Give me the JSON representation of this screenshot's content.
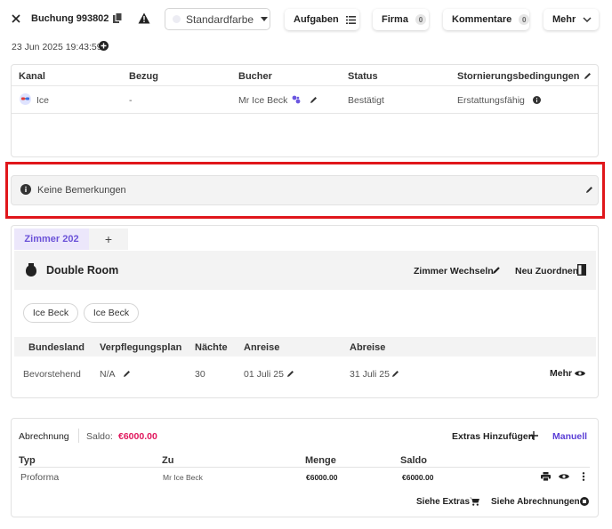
{
  "header": {
    "close_icon": "close-icon",
    "booking_label": "Buchung 993802",
    "timestamp": "23 Jun 2025 19:43:59",
    "color_select": "Standardfarbe",
    "buttons": {
      "aufgaben": "Aufgaben",
      "firma": "Firma",
      "firma_count": "0",
      "kommentare": "Kommentare",
      "kommentare_count": "0",
      "mehr": "Mehr"
    }
  },
  "channel_table": {
    "headers": [
      "Kanal",
      "Bezug",
      "Bucher",
      "Status",
      "Stornierungsbedingungen"
    ],
    "row": {
      "kanal": "Ice",
      "bezug": "-",
      "bucher": "Mr Ice Beck",
      "status": "Bestätigt",
      "storno": "Erstattungsfähig"
    }
  },
  "remarks": {
    "text": "Keine Bemerkungen",
    "highlight_color": "#e0161b"
  },
  "room": {
    "tab_label": "Zimmer 202",
    "add_tab": "+",
    "room_type": "Double Room",
    "change_room": "Zimmer Wechseln",
    "reassign": "Neu Zuordnen",
    "guests": [
      "Ice Beck",
      "Ice Beck"
    ],
    "headers": [
      "Bundesland",
      "Verpflegungsplan",
      "Nächte",
      "Anreise",
      "Abreise"
    ],
    "row": {
      "bundesland": "Bevorstehend",
      "verpflegung": "N/A",
      "naechte": "30",
      "anreise": "01 Juli 25",
      "abreise": "31 Juli 25",
      "mehr": "Mehr"
    }
  },
  "billing": {
    "title": "Abrechnung",
    "saldo_label": "Saldo:",
    "saldo_value": "€6000.00",
    "extras_add": "Extras Hinzufügen",
    "manual": "Manuell",
    "headers": [
      "Typ",
      "Zu",
      "Menge",
      "Saldo"
    ],
    "row": {
      "typ": "Proforma",
      "zu": "Mr Ice Beck",
      "menge": "€6000.00",
      "saldo": "€6000.00"
    },
    "see_extras": "Siehe Extras",
    "see_bills": "Siehe Abrechnungen",
    "accent_color": "#5b3fd6",
    "saldo_color": "#e0165c"
  }
}
